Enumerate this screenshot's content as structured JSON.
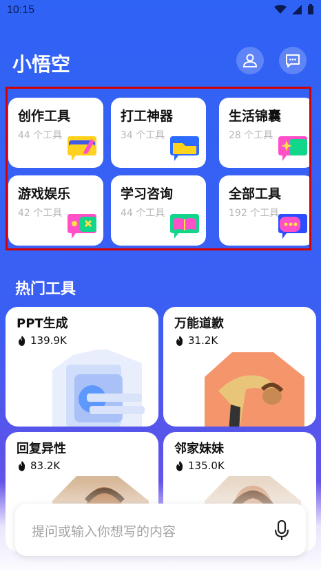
{
  "status": {
    "time": "10:15"
  },
  "app": {
    "title": "小悟空"
  },
  "categories": [
    {
      "title": "创作工具",
      "count": "44 个工具",
      "icon": "pencil-icon"
    },
    {
      "title": "打工神器",
      "count": "34 个工具",
      "icon": "folder-icon"
    },
    {
      "title": "生活锦囊",
      "count": "28 个工具",
      "icon": "sparkle-icon"
    },
    {
      "title": "游戏娱乐",
      "count": "42 个工具",
      "icon": "gamepad-icon"
    },
    {
      "title": "学习咨询",
      "count": "44 个工具",
      "icon": "book-icon"
    },
    {
      "title": "全部工具",
      "count": "192 个工具",
      "icon": "dots-icon"
    }
  ],
  "hot": {
    "section_title": "热门工具",
    "tools": [
      {
        "title": "PPT生成",
        "hot": "139.9K"
      },
      {
        "title": "万能道歉",
        "hot": "31.2K"
      },
      {
        "title": "回复异性",
        "hot": "83.2K"
      },
      {
        "title": "邻家妹妹",
        "hot": "135.0K"
      }
    ]
  },
  "input": {
    "placeholder": "提问或输入你想写的内容"
  },
  "colors": {
    "background": "#2f63f5",
    "accent_yellow": "#ffd21f",
    "accent_green": "#12d68a",
    "accent_pink": "#ff4fc9",
    "accent_blue": "#2b6bff"
  }
}
